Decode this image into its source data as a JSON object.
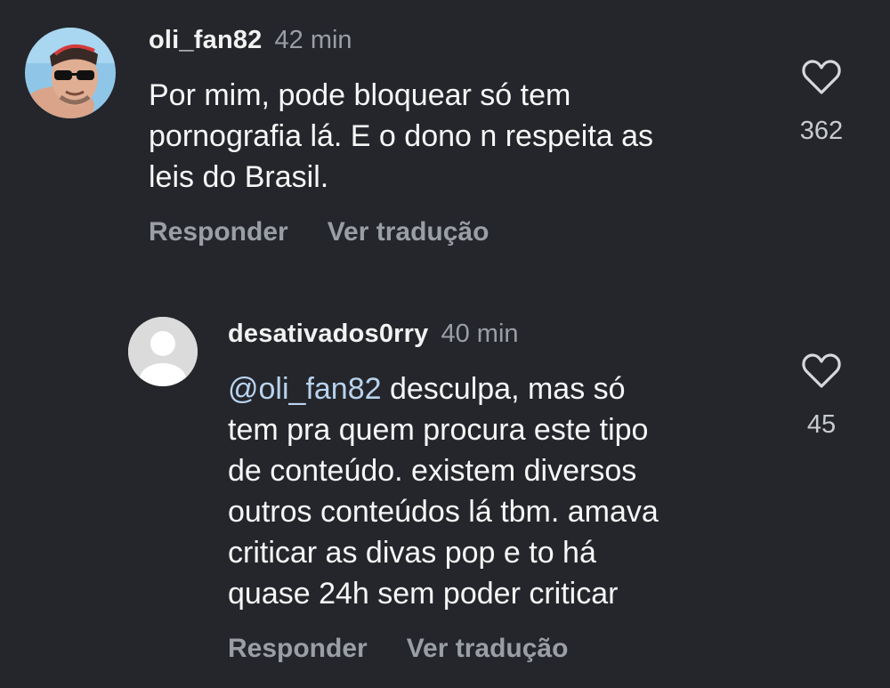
{
  "comments": [
    {
      "username": "oli_fan82",
      "time": "42 min",
      "text": "Por mim, pode bloquear só tem pornografia lá. E o dono n respeita as leis do Brasil.",
      "lines": [
        "Por mim, pode bloquear só tem",
        "pornografia lá. E o dono n respeita as",
        "leis do Brasil."
      ],
      "reply_label": "Responder",
      "translate_label": "Ver tradução",
      "likes": "362",
      "like_icon": "heart-outline-icon",
      "avatar_icon": "profile-photo-avatar"
    },
    {
      "username": "desativados0rry",
      "time": "40 min",
      "mention": "@oli_fan82",
      "lines": [
        " desculpa, mas só",
        "tem pra quem procura este tipo",
        "de conteúdo. existem diversos",
        "outros conteúdos lá tbm. amava",
        "criticar as divas pop e to há",
        "quase 24h sem poder criticar"
      ],
      "reply_label": "Responder",
      "translate_label": "Ver tradução",
      "likes": "45",
      "like_icon": "heart-outline-icon",
      "avatar_icon": "default-user-avatar"
    }
  ],
  "colors": {
    "background": "#24262b",
    "text": "#f7f7f7",
    "muted": "#9a9ea5",
    "mention": "#b9d3ee"
  }
}
